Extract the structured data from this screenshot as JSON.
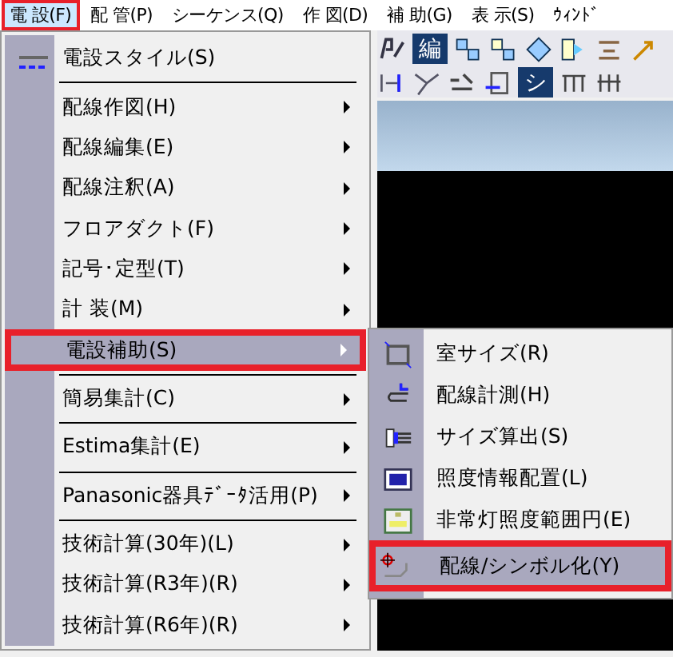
{
  "menubar": [
    {
      "label": "電 設(F)",
      "selected": true,
      "callout": true
    },
    {
      "label": "配 管(P)",
      "selected": false,
      "callout": false
    },
    {
      "label": "シーケンス(Q)",
      "selected": false,
      "callout": false
    },
    {
      "label": "作 図(D)",
      "selected": false,
      "callout": false
    },
    {
      "label": "補 助(G)",
      "selected": false,
      "callout": false
    },
    {
      "label": "表 示(S)",
      "selected": false,
      "callout": false
    },
    {
      "label": "ｳｨﾝﾄﾞ",
      "selected": false,
      "callout": false
    }
  ],
  "toolbar": {
    "row1_button": "編",
    "row2_button": "シ"
  },
  "menu": [
    {
      "kind": "item",
      "label": "電設スタイル(S)",
      "submenu": false,
      "selected": false,
      "callout": false
    },
    {
      "kind": "separator"
    },
    {
      "kind": "item",
      "label": "配線作図(H)",
      "submenu": true,
      "selected": false,
      "callout": false
    },
    {
      "kind": "item",
      "label": "配線編集(E)",
      "submenu": true,
      "selected": false,
      "callout": false
    },
    {
      "kind": "item",
      "label": "配線注釈(A)",
      "submenu": true,
      "selected": false,
      "callout": false
    },
    {
      "kind": "item",
      "label": "フロアダクト(F)",
      "submenu": true,
      "selected": false,
      "callout": false
    },
    {
      "kind": "item",
      "label": "記号･定型(T)",
      "submenu": true,
      "selected": false,
      "callout": false
    },
    {
      "kind": "item",
      "label": "計 装(M)",
      "submenu": true,
      "selected": false,
      "callout": false
    },
    {
      "kind": "item",
      "label": "電設補助(S)",
      "submenu": true,
      "selected": true,
      "callout": true
    },
    {
      "kind": "separator"
    },
    {
      "kind": "item",
      "label": "簡易集計(C)",
      "submenu": true,
      "selected": false,
      "callout": false
    },
    {
      "kind": "separator"
    },
    {
      "kind": "item",
      "label": "Estima集計(E)",
      "submenu": true,
      "selected": false,
      "callout": false
    },
    {
      "kind": "separator"
    },
    {
      "kind": "item",
      "label": "Panasonic器具ﾃﾞｰﾀ活用(P)",
      "submenu": true,
      "selected": false,
      "callout": false
    },
    {
      "kind": "separator"
    },
    {
      "kind": "item",
      "label": "技術計算(30年)(L)",
      "submenu": true,
      "selected": false,
      "callout": false
    },
    {
      "kind": "item",
      "label": "技術計算(R3年)(R)",
      "submenu": true,
      "selected": false,
      "callout": false
    },
    {
      "kind": "item",
      "label": "技術計算(R6年)(R)",
      "submenu": true,
      "selected": false,
      "callout": false
    }
  ],
  "submenu": [
    {
      "label": "室サイズ(R)",
      "selected": false,
      "callout": false
    },
    {
      "label": "配線計測(H)",
      "selected": false,
      "callout": false
    },
    {
      "label": "サイズ算出(S)",
      "selected": false,
      "callout": false
    },
    {
      "label": "照度情報配置(L)",
      "selected": false,
      "callout": false
    },
    {
      "label": "非常灯照度範囲円(E)",
      "selected": false,
      "callout": false
    },
    {
      "label": "配線/シンボル化(Y)",
      "selected": true,
      "callout": true
    }
  ]
}
